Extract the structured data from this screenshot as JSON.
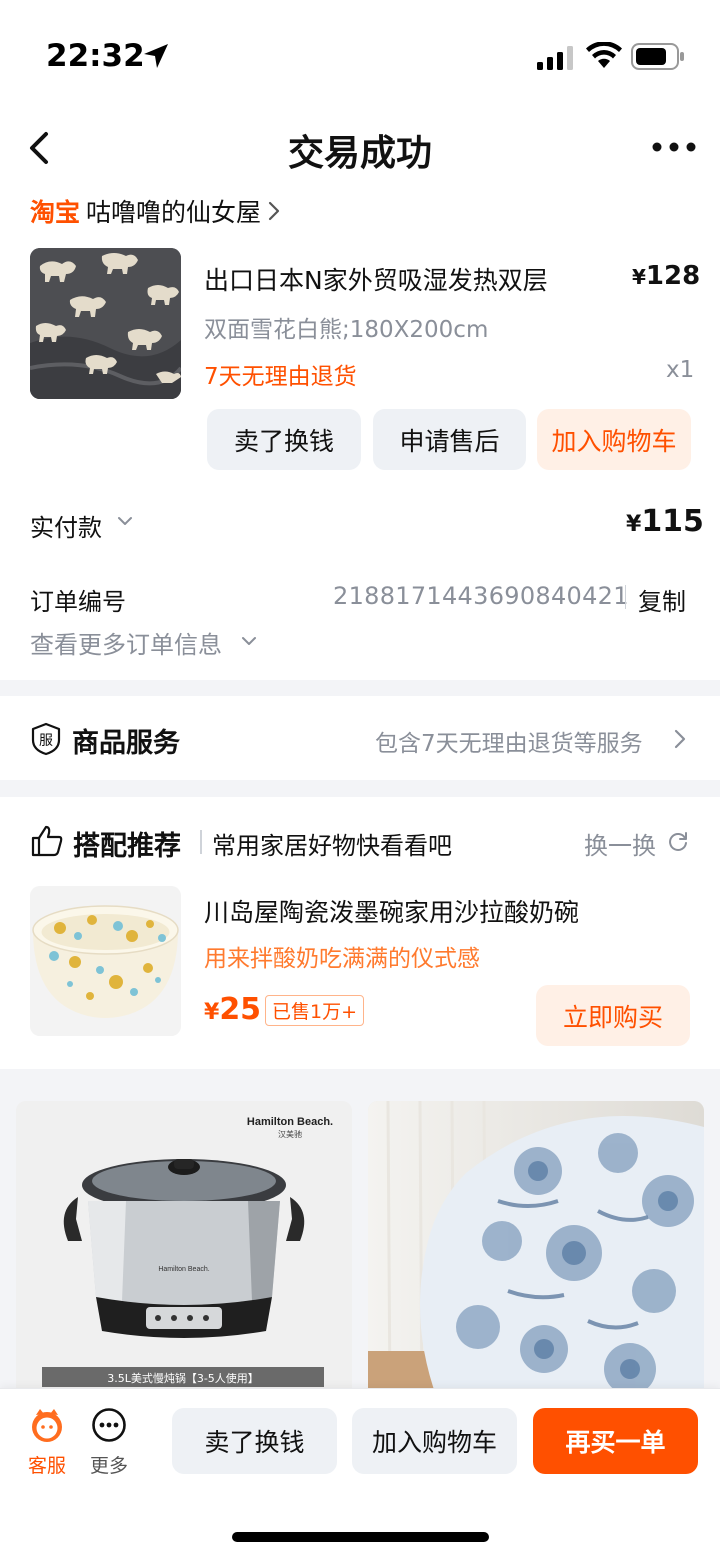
{
  "status_bar": {
    "time": "22:32"
  },
  "header": {
    "title": "交易成功"
  },
  "shop": {
    "platform": "淘宝",
    "name": "咕噜噜的仙女屋"
  },
  "product": {
    "title": "出口日本N家外贸吸湿发热双层",
    "price_symbol": "¥",
    "price": "128",
    "sku": "双面雪花白熊;180X200cm",
    "return_policy": "7天无理由退货",
    "quantity": "x1",
    "actions": {
      "sell": "卖了换钱",
      "after_sale": "申请售后",
      "add_cart": "加入购物车"
    }
  },
  "payment": {
    "label": "实付款",
    "symbol": "¥",
    "amount": "115"
  },
  "order": {
    "number_label": "订单编号",
    "number": "2188171443690840421",
    "copy": "复制",
    "more_info": "查看更多订单信息"
  },
  "services": {
    "title": "商品服务",
    "icon_text": "服",
    "description": "包含7天无理由退货等服务"
  },
  "recommend": {
    "title": "搭配推荐",
    "subtitle": "常用家居好物快看看吧",
    "refresh": "换一换",
    "item": {
      "title": "川岛屋陶瓷泼墨碗家用沙拉酸奶碗",
      "subtitle": "用来拌酸奶吃满满的仪式感",
      "price_symbol": "¥",
      "price": "25",
      "sold": "已售1万+",
      "buy": "立即购买"
    }
  },
  "feed": {
    "left": {
      "brand": "Hamilton Beach.",
      "brand_cn": "汉美驰",
      "caption": "3.5L美式慢炖锅【3-5人使用】"
    }
  },
  "bottom_bar": {
    "service": "客服",
    "more": "更多",
    "sell": "卖了换钱",
    "add_cart": "加入购物车",
    "rebuy": "再买一单"
  },
  "colors": {
    "accent": "#ff5000",
    "accent_soft": "#fff0e6",
    "muted": "#8a8f99",
    "button_gray": "#eef1f5"
  }
}
